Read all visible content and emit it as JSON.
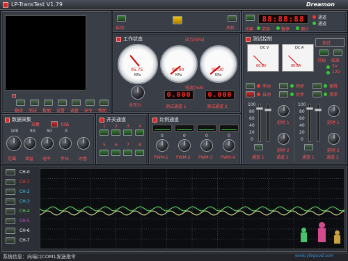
{
  "app": {
    "title": "LP-TransTest V1.79",
    "brand": "Dreamon"
  },
  "top_left": {
    "buttons": [
      "翻译",
      "测试",
      "数据",
      "设置",
      "调盘",
      "命令",
      "帮助"
    ],
    "start_label": "启动",
    "close_label": "关机"
  },
  "clock": {
    "display": "88:88:88",
    "labels": [
      "切换",
      "实验",
      "暂停",
      "倒计"
    ],
    "tags": [
      "通道",
      "通道"
    ]
  },
  "work_status": {
    "title": "工作状态",
    "pressure_title": "压力(KPa)",
    "current_title": "电流(mA)",
    "gauge1": {
      "value": "05.75",
      "unit": "KPa"
    },
    "gauge2": {
      "value": "00.00",
      "unit": "KPa"
    },
    "gauge3": {
      "value": "00.00",
      "unit": "KPa"
    },
    "total_pressure_label": "总压力",
    "test_ch1_label": "测试通道 1",
    "test_ch2_label": "测试通道 2",
    "seg1": "0.000",
    "seg2": "0.000"
  },
  "test_control": {
    "title": "测试控制",
    "meter1": {
      "label": "DC V",
      "value": "00.0V"
    },
    "meter2": {
      "label": "DC A",
      "value": "00.0A"
    },
    "mode_label": "测试",
    "start_label": "开始",
    "end_label": "结束",
    "v1": "5V",
    "v2": "12V",
    "manual_label": "手动",
    "auto_label": "自动",
    "sync_label": "同步",
    "async_label": "异步",
    "hold_label": "保持",
    "clear_label": "清零",
    "sliders": [
      {
        "scale": [
          "100",
          "80",
          "60",
          "40",
          "20",
          "0"
        ]
      },
      {
        "scale": [
          "100",
          "80",
          "60",
          "40",
          "20",
          "0"
        ]
      }
    ],
    "delay1": "延时 1",
    "delay2": "延时 2",
    "delay1b": "延时 1",
    "delay2b": "延时 2",
    "channel1": "通道 1",
    "channel2": "通道 2",
    "channel1b": "通道 1",
    "channel2b": "通道 2"
  },
  "acq": {
    "title": "数据采集",
    "sample_label": "采集",
    "scan_label": "扫描",
    "scales": [
      "100",
      "50",
      "50",
      "0"
    ],
    "knob_labels": [
      "范围",
      "增益",
      "电平",
      "步长",
      "时基"
    ]
  },
  "switch_ch": {
    "title": "开关通道",
    "numbers": [
      "1",
      "2",
      "3",
      "4",
      "5",
      "6",
      "7",
      "8"
    ]
  },
  "prop_ch": {
    "title": "比例通道",
    "knob_labels": [
      "PWM-1",
      "PWM-2",
      "PWM-3",
      "PWM-4"
    ],
    "knob_values": [
      "0",
      "0",
      "0",
      "0"
    ]
  },
  "scope": {
    "channels": [
      {
        "name": "CH-0",
        "color": "#ffffff"
      },
      {
        "name": "CH-1",
        "color": "#ff4040"
      },
      {
        "name": "CH-2",
        "color": "#3fd2ff"
      },
      {
        "name": "CH-3",
        "color": "#3fd2ff"
      },
      {
        "name": "CH-4",
        "color": "#55ee55"
      },
      {
        "name": "CH-5",
        "color": "#dd55dd"
      },
      {
        "name": "CH-6",
        "color": "#ffffff"
      },
      {
        "name": "CH-7",
        "color": "#ffffff"
      }
    ],
    "wave_color": "#6cf26c"
  },
  "status": {
    "text": "系统信息：向端口COM1发送指令",
    "watermark": "www.ytegood.com"
  }
}
